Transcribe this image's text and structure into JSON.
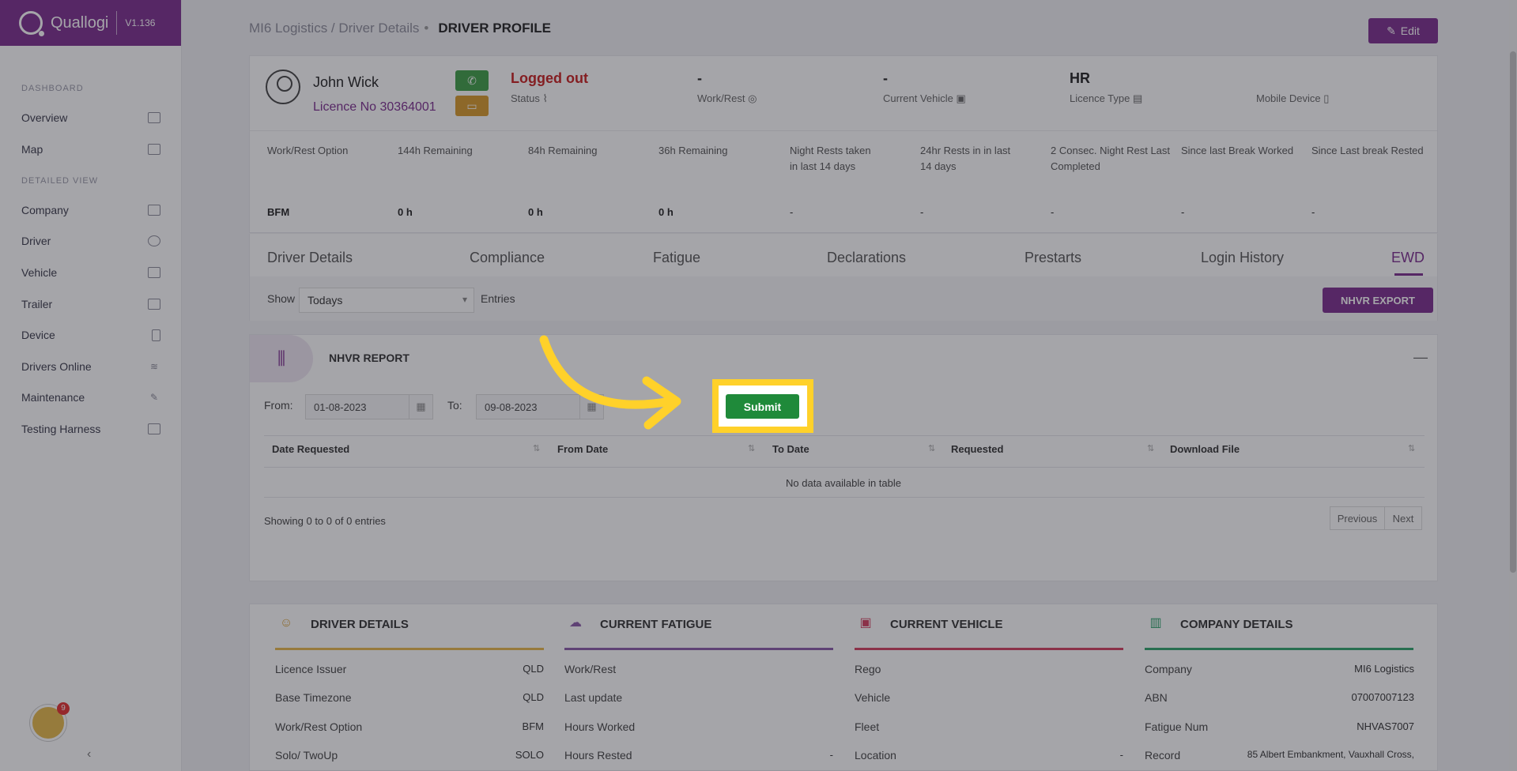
{
  "app": {
    "name": "Quallogi",
    "version": "V1.136"
  },
  "sidebar": {
    "section_dashboard": "DASHBOARD",
    "section_detailed": "DETAILED VIEW",
    "items": [
      {
        "label": "Overview",
        "icon": "grid-icon"
      },
      {
        "label": "Map",
        "icon": "map-icon"
      },
      {
        "label": "Company",
        "icon": "building-icon"
      },
      {
        "label": "Driver",
        "icon": "user-icon"
      },
      {
        "label": "Vehicle",
        "icon": "truck-icon"
      },
      {
        "label": "Trailer",
        "icon": "trailer-icon"
      },
      {
        "label": "Device",
        "icon": "phone-icon"
      },
      {
        "label": "Drivers Online",
        "icon": "wifi-icon"
      },
      {
        "label": "Maintenance",
        "icon": "wrench-icon"
      },
      {
        "label": "Testing Harness",
        "icon": "monitor-icon"
      }
    ],
    "badge_count": "9"
  },
  "header": {
    "breadcrumb": "MI6 Logistics / Driver Details",
    "page_title": "DRIVER PROFILE",
    "edit_label": "Edit"
  },
  "driver": {
    "name": "John Wick",
    "licence": "Licence No 30364001",
    "status_value": "Logged out",
    "status_label": "Status",
    "workrest_value": "-",
    "workrest_label": "Work/Rest",
    "vehicle_value": "-",
    "vehicle_label": "Current Vehicle",
    "licence_type_value": "HR",
    "licence_type_label": "Licence Type",
    "mobile_label": "Mobile Device"
  },
  "fatigue": {
    "headers": [
      "Work/Rest Option",
      "144h Remaining",
      "84h Remaining",
      "36h Remaining",
      "Night Rests taken in last 14 days",
      "24hr Rests in in last 14 days",
      "2 Consec. Night Rest Last Completed",
      "Since last Break Worked",
      "Since Last break Rested"
    ],
    "values": [
      "BFM",
      "0 h",
      "0 h",
      "0 h",
      "-",
      "-",
      "-",
      "-",
      "-"
    ]
  },
  "tabs": [
    "Driver Details",
    "Compliance",
    "Fatigue",
    "Declarations",
    "Prestarts",
    "Login History",
    "EWD"
  ],
  "filter": {
    "show_label": "Show",
    "selected": "Todays",
    "entries_label": "Entries",
    "export_label": "NHVR EXPORT"
  },
  "report": {
    "title": "NHVR REPORT",
    "from_label": "From:",
    "from_value": "01-08-2023",
    "to_label": "To:",
    "to_value": "09-08-2023",
    "submit_label": "Submit",
    "columns": [
      "Date Requested",
      "From Date",
      "To Date",
      "Requested",
      "Download File"
    ],
    "empty_text": "No data available in table",
    "showing_text": "Showing 0 to 0 of 0 entries",
    "prev_label": "Previous",
    "next_label": "Next"
  },
  "bottom": {
    "driver_details": {
      "title": "DRIVER DETAILS",
      "rows": [
        {
          "label": "Licence Issuer",
          "value": "QLD"
        },
        {
          "label": "Base Timezone",
          "value": "QLD"
        },
        {
          "label": "Work/Rest Option",
          "value": "BFM"
        },
        {
          "label": "Solo/ TwoUp",
          "value": "SOLO"
        }
      ]
    },
    "current_fatigue": {
      "title": "CURRENT FATIGUE",
      "rows": [
        {
          "label": "Work/Rest",
          "value": ""
        },
        {
          "label": "Last update",
          "value": ""
        },
        {
          "label": "Hours Worked",
          "value": ""
        },
        {
          "label": "Hours Rested",
          "value": "-"
        }
      ]
    },
    "current_vehicle": {
      "title": "CURRENT VEHICLE",
      "rows": [
        {
          "label": "Rego",
          "value": ""
        },
        {
          "label": "Vehicle",
          "value": ""
        },
        {
          "label": "Fleet",
          "value": ""
        },
        {
          "label": "Location",
          "value": "-"
        }
      ]
    },
    "company_details": {
      "title": "COMPANY DETAILS",
      "rows": [
        {
          "label": "Company",
          "value": "MI6 Logistics"
        },
        {
          "label": "ABN",
          "value": "07007007123"
        },
        {
          "label": "Fatigue Num",
          "value": "NHVAS7007"
        },
        {
          "label": "Record",
          "value": "85 Albert Embankment, Vauxhall Cross,"
        }
      ]
    }
  },
  "colors": {
    "brand": "#7c2d8e",
    "highlight": "#ffd12a",
    "submit": "#1f8a3a",
    "status_red": "#c81e1e"
  }
}
